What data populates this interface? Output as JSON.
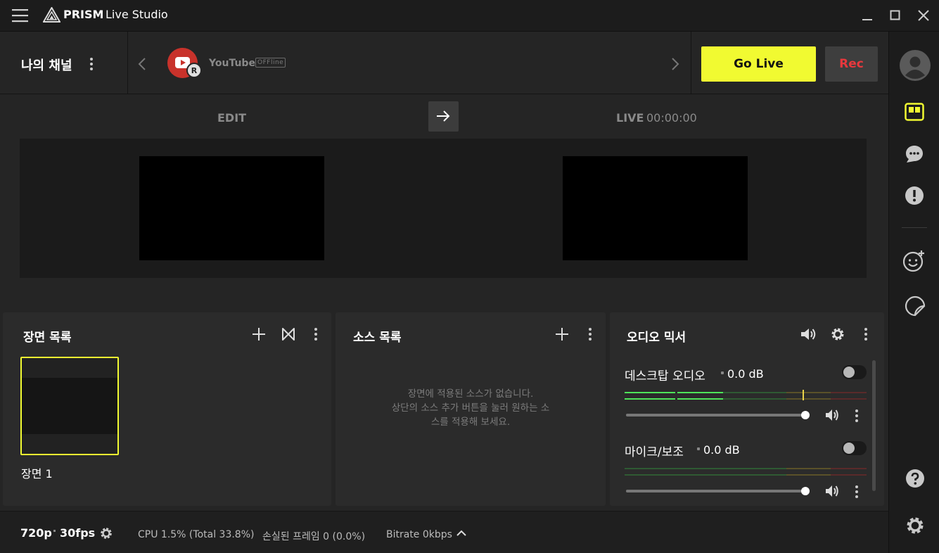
{
  "titlebar": {
    "brand": "PRISM",
    "product": "Live Studio"
  },
  "channel": {
    "title": "나의 채널",
    "platform_name": "YouTube",
    "platform_status": "OFFline",
    "avatar_badge": "R",
    "go_live_label": "Go Live",
    "rec_label": "Rec"
  },
  "preview": {
    "edit_label": "EDIT",
    "live_label": "LIVE",
    "live_time": "00:00:00"
  },
  "scenes": {
    "title": "장면 목록",
    "items": [
      {
        "label": "장면 1",
        "selected": true
      }
    ]
  },
  "sources": {
    "title": "소스 목록",
    "empty_line1": "장면에 적용된 소스가 없습니다.",
    "empty_line2": "상단의 소스 추가 버튼을 눌러 원하는 소",
    "empty_line3": "스를 적용해 보세요."
  },
  "mixer": {
    "title": "오디오 믹서",
    "channels": [
      {
        "name": "데스크탑 오디오",
        "db": "0.0 dB",
        "volume": 1.0,
        "active": true
      },
      {
        "name": "마이크/보조",
        "db": "0.0 dB",
        "volume": 1.0,
        "active": false
      }
    ]
  },
  "status": {
    "resolution": "720p",
    "fps": "30fps",
    "cpu": "CPU 1.5% (Total 33.8%)",
    "dropped": "손실된 프레임 0 (0.0%)",
    "bitrate": "Bitrate 0kbps"
  },
  "colors": {
    "accent": "#f1fa31",
    "rec": "#e8383d",
    "background": "#252525",
    "panel": "#2b2b2b",
    "meter_green": "#4ee65a"
  },
  "icons": [
    "menu-icon",
    "prism-logo-icon",
    "minimize-icon",
    "maximize-icon",
    "close-icon",
    "kebab-icon",
    "chevron-left-icon",
    "chevron-right-icon",
    "youtube-icon",
    "arrow-right-icon",
    "plus-icon",
    "transition-icon",
    "speaker-icon",
    "gear-icon",
    "chevron-up-icon",
    "profile-icon",
    "layout-icon",
    "chat-icon",
    "notice-icon",
    "beauty-icon",
    "sticker-icon",
    "help-icon"
  ]
}
